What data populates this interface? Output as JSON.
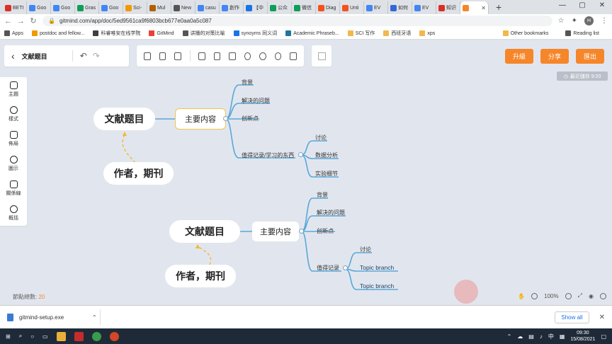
{
  "browser": {
    "tabs": [
      {
        "label": "BETI",
        "color": "#d93025"
      },
      {
        "label": "Goo",
        "color": "#4285f4"
      },
      {
        "label": "Goo",
        "color": "#4285f4"
      },
      {
        "label": "Gras",
        "color": "#0f9d58"
      },
      {
        "label": "Goo",
        "color": "#4285f4"
      },
      {
        "label": "Sci-",
        "color": "#f29900"
      },
      {
        "label": "Mul",
        "color": "#b06000"
      },
      {
        "label": "New",
        "color": "#555555"
      },
      {
        "label": "casu",
        "color": "#4285f4"
      },
      {
        "label": "創作",
        "color": "#4285f4"
      },
      {
        "label": "【中",
        "color": "#1a73e8"
      },
      {
        "label": "公众",
        "color": "#0f9d58"
      },
      {
        "label": "微信",
        "color": "#0f9d58"
      },
      {
        "label": "Diag",
        "color": "#f4511e"
      },
      {
        "label": "Unti",
        "color": "#f4511e"
      },
      {
        "label": "EV",
        "color": "#4285f4"
      },
      {
        "label": "如何",
        "color": "#3367d6"
      },
      {
        "label": "EV",
        "color": "#4285f4"
      },
      {
        "label": "知识",
        "color": "#d93025"
      },
      {
        "label": "",
        "color": "#f6862a"
      }
    ],
    "address": "gitmind.com/app/doc/5ed9561ca9f6803bcb677e0aa0a5c087",
    "profile_initial": "H",
    "bookmarks": [
      {
        "label": "Apps",
        "color": "#555555"
      },
      {
        "label": "postdoc and fellow...",
        "color": "#f29900"
      },
      {
        "label": "科睿唯安在线学院",
        "color": "#3c4043"
      },
      {
        "label": "GitMind",
        "color": "#e94235"
      },
      {
        "label": "讲播的对策比喻",
        "color": "#555555"
      },
      {
        "label": "synoyms 同义词",
        "color": "#1a73e8"
      },
      {
        "label": "Academic Phraseb...",
        "color": "#21759b"
      },
      {
        "label": "SCI 写作",
        "color": "#f2b84b"
      },
      {
        "label": "西班牙语",
        "color": "#f2b84b"
      },
      {
        "label": "xps",
        "color": "#f2b84b"
      }
    ],
    "bookmarks_right": [
      "Other bookmarks",
      "Reading list"
    ]
  },
  "toolbar": {
    "doc_title": "文献题目",
    "upgrade": "升級",
    "share": "分享",
    "export": "匯出",
    "save_status": "最近儲存 9:20"
  },
  "sidepanel": [
    {
      "label": "主題",
      "icon": "theme-icon"
    },
    {
      "label": "樣式",
      "icon": "style-icon"
    },
    {
      "label": "佈局",
      "icon": "layout-icon"
    },
    {
      "label": "圖示",
      "icon": "marker-icon"
    },
    {
      "label": "關係線",
      "icon": "relation-line-icon"
    },
    {
      "label": "概括",
      "icon": "summary-icon"
    }
  ],
  "mindmap1": {
    "root": "文献题目",
    "author": "作者，期刊",
    "main": "主要内容",
    "leaves": [
      "背景",
      "解决的问题",
      "创新点",
      "值得记录/学习的东西"
    ],
    "subleaves": [
      "讨论",
      "数据分析",
      "实验细节"
    ]
  },
  "mindmap2": {
    "root": "文献题目",
    "author": "作者，期刊",
    "main": "主要内容",
    "leaves": [
      "背景",
      "解决的问题",
      "创新点",
      "值得记录"
    ],
    "subleaves": [
      "讨论",
      "Topic branch",
      "Topic branch"
    ]
  },
  "footer": {
    "node_count_label": "節點總數: ",
    "node_count": "20",
    "zoom": "100%"
  },
  "download": {
    "file": "gitmind-setup.exe",
    "show_all": "Show all"
  },
  "taskbar": {
    "time": "09:30",
    "date": "15/08/2021",
    "ime": "中"
  },
  "colors": {
    "accent": "#f6862a",
    "branch": "#5aa7d8",
    "dashed": "#f5b731"
  }
}
